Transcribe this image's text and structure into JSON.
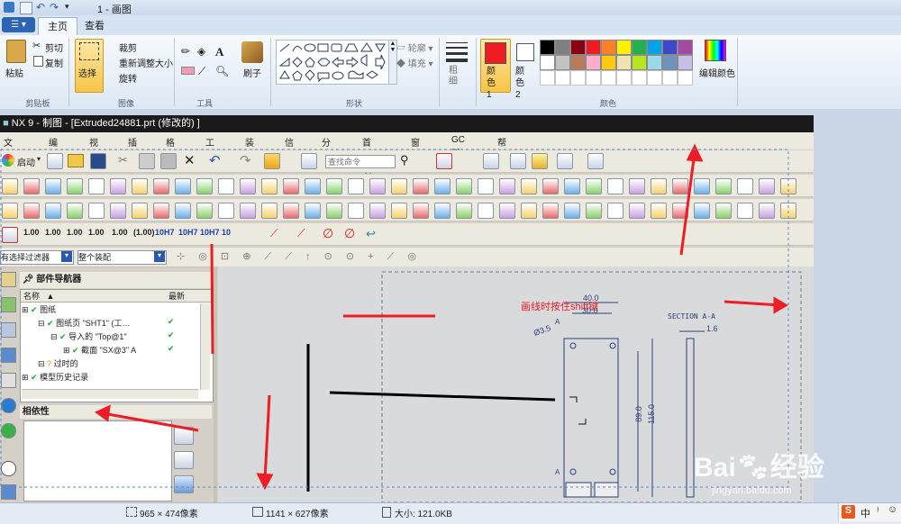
{
  "paint": {
    "title": "1 - 画图",
    "tabs": [
      "主页",
      "查看"
    ],
    "ribbon": {
      "clipboard": {
        "paste": "粘贴",
        "cut": "剪切",
        "copy": "复制",
        "group": "剪贴板"
      },
      "image": {
        "select": "选择",
        "crop": "裁剪",
        "resize": "重新调整大小",
        "rotate": "旋转",
        "group": "图像"
      },
      "tools": {
        "group": "工具"
      },
      "brush": {
        "label": "刷子"
      },
      "shapes": {
        "outline": "轮廓",
        "fill": "填充",
        "group": "形状"
      },
      "size": {
        "label": "粗细"
      },
      "colors": {
        "color1": "颜色 1",
        "color2": "颜色 2",
        "edit": "编辑颜色",
        "group": "颜色",
        "color1_value": "#ee1c24",
        "color2_value": "#ffffff",
        "palette_row1": [
          "#000000",
          "#7f7f7f",
          "#880015",
          "#ed1c24",
          "#ff7f27",
          "#fff200",
          "#22b14c",
          "#00a2e8",
          "#3f48cc",
          "#a349a4"
        ],
        "palette_row2": [
          "#ffffff",
          "#c3c3c3",
          "#b97a57",
          "#ffaec9",
          "#ffc90e",
          "#efe4b0",
          "#b5e61d",
          "#99d9ea",
          "#7092be",
          "#c8bfe7"
        ]
      }
    },
    "status": {
      "selection": "965 × 474像素",
      "canvas": "1141 × 627像素",
      "size": "大小: 121.0KB"
    }
  },
  "nx": {
    "title": "NX 9 - 制图 - [Extruded24881.prt (修改的) ]",
    "menu": [
      "文件(F)",
      "编辑(E)",
      "视图(V)",
      "插入(S)",
      "格式(R)",
      "工具(T)",
      "装配(A)",
      "信息(I)",
      "分析(L)",
      "首选项(P)",
      "窗口(O)",
      "GC 工具箱",
      "帮助(H)"
    ],
    "start": "启动",
    "search_placeholder": "查找命令",
    "filter": "有选择过滤器",
    "assembly": "整个装配",
    "decimals": [
      "1.00",
      "1.00",
      "1.00",
      "1.00",
      "1.00",
      "(1.00)",
      "10H7",
      "10H7",
      "10H7",
      "10"
    ],
    "navigator": {
      "title": "部件导航器",
      "col_name": "名称",
      "col_latest": "最新",
      "rows": [
        "图纸",
        "图纸页 \"SHT1\" (工…",
        "导入的 \"Top@1\"",
        "截面 \"SX@3\" A",
        "过时的",
        "模型历史记录"
      ]
    },
    "dependency": "相依性"
  },
  "annotation": "画线时按住shift键",
  "drawing": {
    "section": "SECTION A-A",
    "dims": [
      "40.0",
      "30.0",
      "Ø3.5",
      "A",
      "A",
      "89.0",
      "115.0",
      "1.6"
    ]
  },
  "watermark": {
    "brand": "Bai",
    "brand2": "经验",
    "url": "jingyan.baidu.com"
  },
  "tray": {
    "input": "中"
  }
}
